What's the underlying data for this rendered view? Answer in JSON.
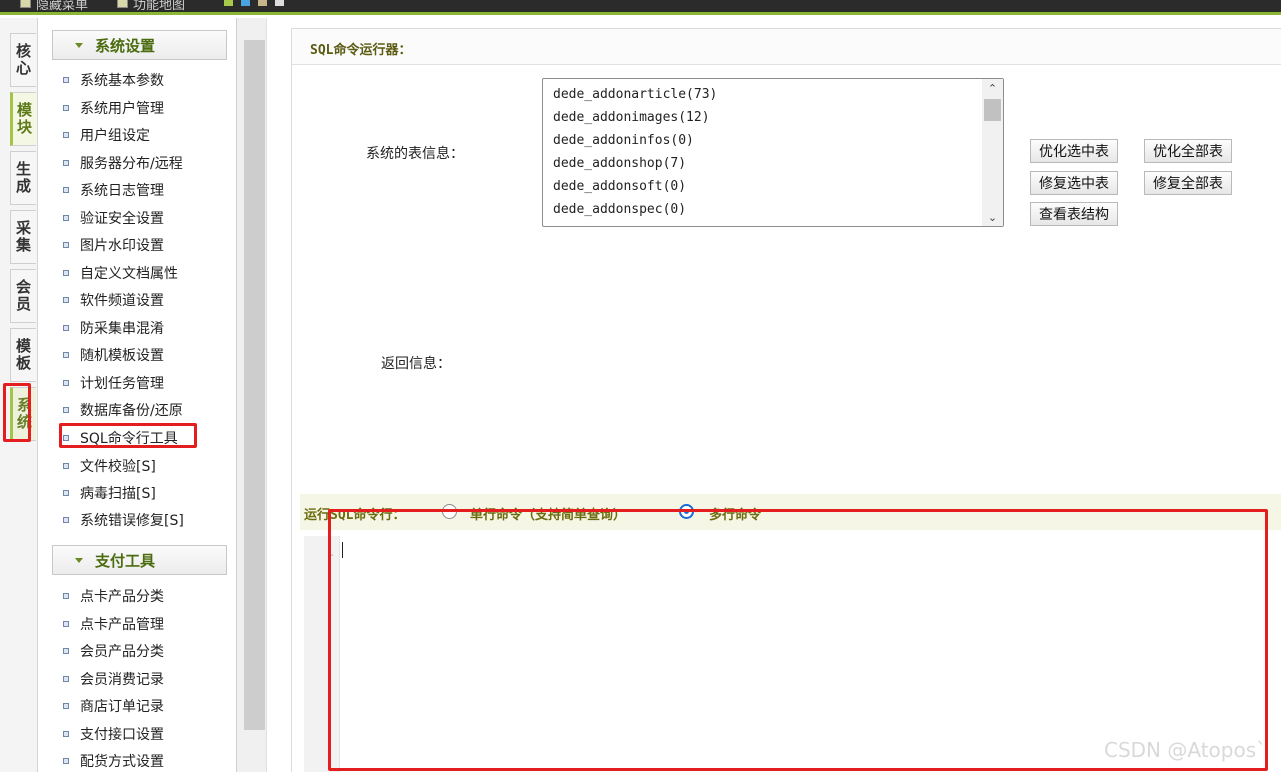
{
  "topbar": {
    "items": [
      "隐藏菜单",
      "功能地图"
    ],
    "squares": [
      "#a8c84a",
      "#4aa3df",
      "#c8b48a",
      "#dddddd"
    ]
  },
  "vtabs": [
    "核心",
    "模块",
    "生成",
    "采集",
    "会员",
    "模板",
    "系统"
  ],
  "menu": {
    "groups": [
      {
        "title": "系统设置",
        "items": [
          "系统基本参数",
          "系统用户管理",
          "用户组设定",
          "服务器分布/远程",
          "系统日志管理",
          "验证安全设置",
          "图片水印设置",
          "自定义文档属性",
          "软件频道设置",
          "防采集串混淆",
          "随机模板设置",
          "计划任务管理",
          "数据库备份/还原",
          "SQL命令行工具",
          "文件校验[S]",
          "病毒扫描[S]",
          "系统错误修复[S]"
        ]
      },
      {
        "title": "支付工具",
        "items": [
          "点卡产品分类",
          "点卡产品管理",
          "会员产品分类",
          "会员消费记录",
          "商店订单记录",
          "支付接口设置",
          "配货方式设置"
        ]
      }
    ]
  },
  "main": {
    "title": "SQL命令运行器：",
    "table_info_label": "系统的表信息：",
    "tables": [
      "dede_addonarticle(73)",
      "dede_addonimages(12)",
      "dede_addoninfos(0)",
      "dede_addonshop(7)",
      "dede_addonsoft(0)",
      "dede_addonspec(0)"
    ],
    "buttons": {
      "optimize_selected": "优化选中表",
      "optimize_all": "优化全部表",
      "repair_selected": "修复选中表",
      "repair_all": "修复全部表",
      "view_structure": "查看表结构"
    },
    "return_label": "返回信息：",
    "cmd_label_prefix": "运行",
    "cmd_label_sql": "SQL",
    "cmd_label_suffix": "命令行：",
    "radio_single": "单行命令（支持简单查询）",
    "radio_multi": "多行命令",
    "selected_mode": "多行命令"
  },
  "watermark": "CSDN @Atopos`"
}
